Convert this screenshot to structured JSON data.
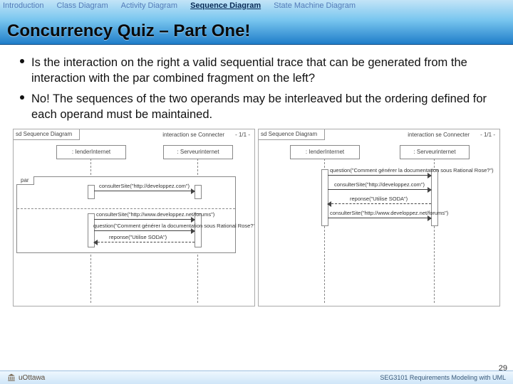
{
  "nav": {
    "items": [
      "Introduction",
      "Class Diagram",
      "Activity Diagram",
      "Sequence Diagram",
      "State Machine Diagram"
    ],
    "activeIndex": 3
  },
  "title": "Concurrency Quiz – Part One!",
  "bullets": [
    "Is the interaction on the right a valid sequential trace that can be generated from the interaction with the par combined fragment on the left?",
    "No! The sequences of the two operands may be interleaved but the ordering defined for each operand must be maintained."
  ],
  "sd_left": {
    "frame": "sd  Sequence Diagram",
    "header": "interaction se Connecter",
    "suffix": "- 1/1 -",
    "lifeline_a": ": IenderInternet",
    "lifeline_b": ": Serveurinternet",
    "par": "par",
    "m1": "consulterSite(\"http://developpez.com\")",
    "m2": "consulterSite(\"http://www.developpez.net/forums\")",
    "m3": "question(\"Comment générer la documentation sous Rational Rose?\")",
    "m4": "reponse(\"Utilise SODA\")"
  },
  "sd_right": {
    "frame": "sd  Sequence Diagram",
    "header": "interaction se Connecter",
    "suffix": "- 1/1 -",
    "lifeline_a": ": IenderInternet",
    "lifeline_b": ": Serveurinternet",
    "m1": "question(\"Comment générer la documentation sous Rational Rose?\")",
    "m2": "consulterSite(\"http://developpez.com\")",
    "m3": "reponse(\"Utilise SODA\")",
    "m4": "consulterSite(\"http://www.developpez.net/forums\")"
  },
  "footer": {
    "org": "uOttawa",
    "course": "SEG3101  Requirements Modeling with UML",
    "page": "29"
  }
}
